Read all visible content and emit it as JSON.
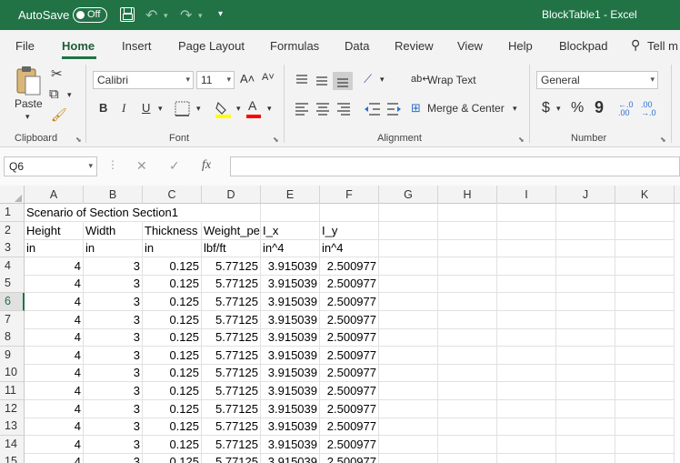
{
  "titlebar": {
    "autosave_label": "AutoSave",
    "autosave_state": "Off",
    "title": "BlockTable1  -  Excel",
    "bg_color": "#217346"
  },
  "tabs": [
    {
      "label": "File",
      "active": false
    },
    {
      "label": "Home",
      "active": true
    },
    {
      "label": "Insert",
      "active": false
    },
    {
      "label": "Page Layout",
      "active": false
    },
    {
      "label": "Formulas",
      "active": false
    },
    {
      "label": "Data",
      "active": false
    },
    {
      "label": "Review",
      "active": false
    },
    {
      "label": "View",
      "active": false
    },
    {
      "label": "Help",
      "active": false
    },
    {
      "label": "Blockpad",
      "active": false
    },
    {
      "label": "Tell m",
      "active": false
    }
  ],
  "ribbon": {
    "clipboard": {
      "label": "Clipboard",
      "paste_label": "Paste"
    },
    "font": {
      "label": "Font",
      "font_name": "Calibri",
      "font_size": "11",
      "bold": "B",
      "italic": "I",
      "underline": "U",
      "grow": "A˄",
      "shrink": "A˅",
      "highlight_color": "#ffff00",
      "font_color": "#ff0000"
    },
    "alignment": {
      "label": "Alignment",
      "wrap_text": "Wrap Text",
      "merge_center": "Merge & Center"
    },
    "number": {
      "label": "Number",
      "format": "General",
      "currency": "$",
      "percent": "%",
      "comma": "9",
      "inc_decimal": "←.0 .00",
      "dec_decimal": ".00 →.0"
    }
  },
  "formula_bar": {
    "name_box": "Q6",
    "cancel": "✕",
    "enter": "✓",
    "fx": "fx",
    "value": ""
  },
  "grid": {
    "columns": [
      "A",
      "B",
      "C",
      "D",
      "E",
      "F",
      "G",
      "H",
      "I",
      "J",
      "K"
    ],
    "selected_row": "6",
    "rows": [
      {
        "num": "1",
        "cells": [
          "Scenario of Section Section1",
          "",
          "",
          "",
          "",
          ""
        ]
      },
      {
        "num": "2",
        "cells": [
          "Height",
          "Width",
          "Thickness",
          "Weight_pe",
          "I_x",
          "I_y"
        ]
      },
      {
        "num": "3",
        "cells": [
          "in",
          "in",
          "in",
          "lbf/ft",
          "in^4",
          "in^4"
        ]
      },
      {
        "num": "4",
        "cells": [
          "4",
          "3",
          "0.125",
          "5.77125",
          "3.915039",
          "2.500977"
        ]
      },
      {
        "num": "5",
        "cells": [
          "4",
          "3",
          "0.125",
          "5.77125",
          "3.915039",
          "2.500977"
        ]
      },
      {
        "num": "6",
        "cells": [
          "4",
          "3",
          "0.125",
          "5.77125",
          "3.915039",
          "2.500977"
        ]
      },
      {
        "num": "7",
        "cells": [
          "4",
          "3",
          "0.125",
          "5.77125",
          "3.915039",
          "2.500977"
        ]
      },
      {
        "num": "8",
        "cells": [
          "4",
          "3",
          "0.125",
          "5.77125",
          "3.915039",
          "2.500977"
        ]
      },
      {
        "num": "9",
        "cells": [
          "4",
          "3",
          "0.125",
          "5.77125",
          "3.915039",
          "2.500977"
        ]
      },
      {
        "num": "10",
        "cells": [
          "4",
          "3",
          "0.125",
          "5.77125",
          "3.915039",
          "2.500977"
        ]
      },
      {
        "num": "11",
        "cells": [
          "4",
          "3",
          "0.125",
          "5.77125",
          "3.915039",
          "2.500977"
        ]
      },
      {
        "num": "12",
        "cells": [
          "4",
          "3",
          "0.125",
          "5.77125",
          "3.915039",
          "2.500977"
        ]
      },
      {
        "num": "13",
        "cells": [
          "4",
          "3",
          "0.125",
          "5.77125",
          "3.915039",
          "2.500977"
        ]
      },
      {
        "num": "14",
        "cells": [
          "4",
          "3",
          "0.125",
          "5.77125",
          "3.915039",
          "2.500977"
        ]
      },
      {
        "num": "15",
        "cells": [
          "4",
          "3",
          "0.125",
          "5.77125",
          "3.915039",
          "2.500977"
        ]
      }
    ]
  }
}
